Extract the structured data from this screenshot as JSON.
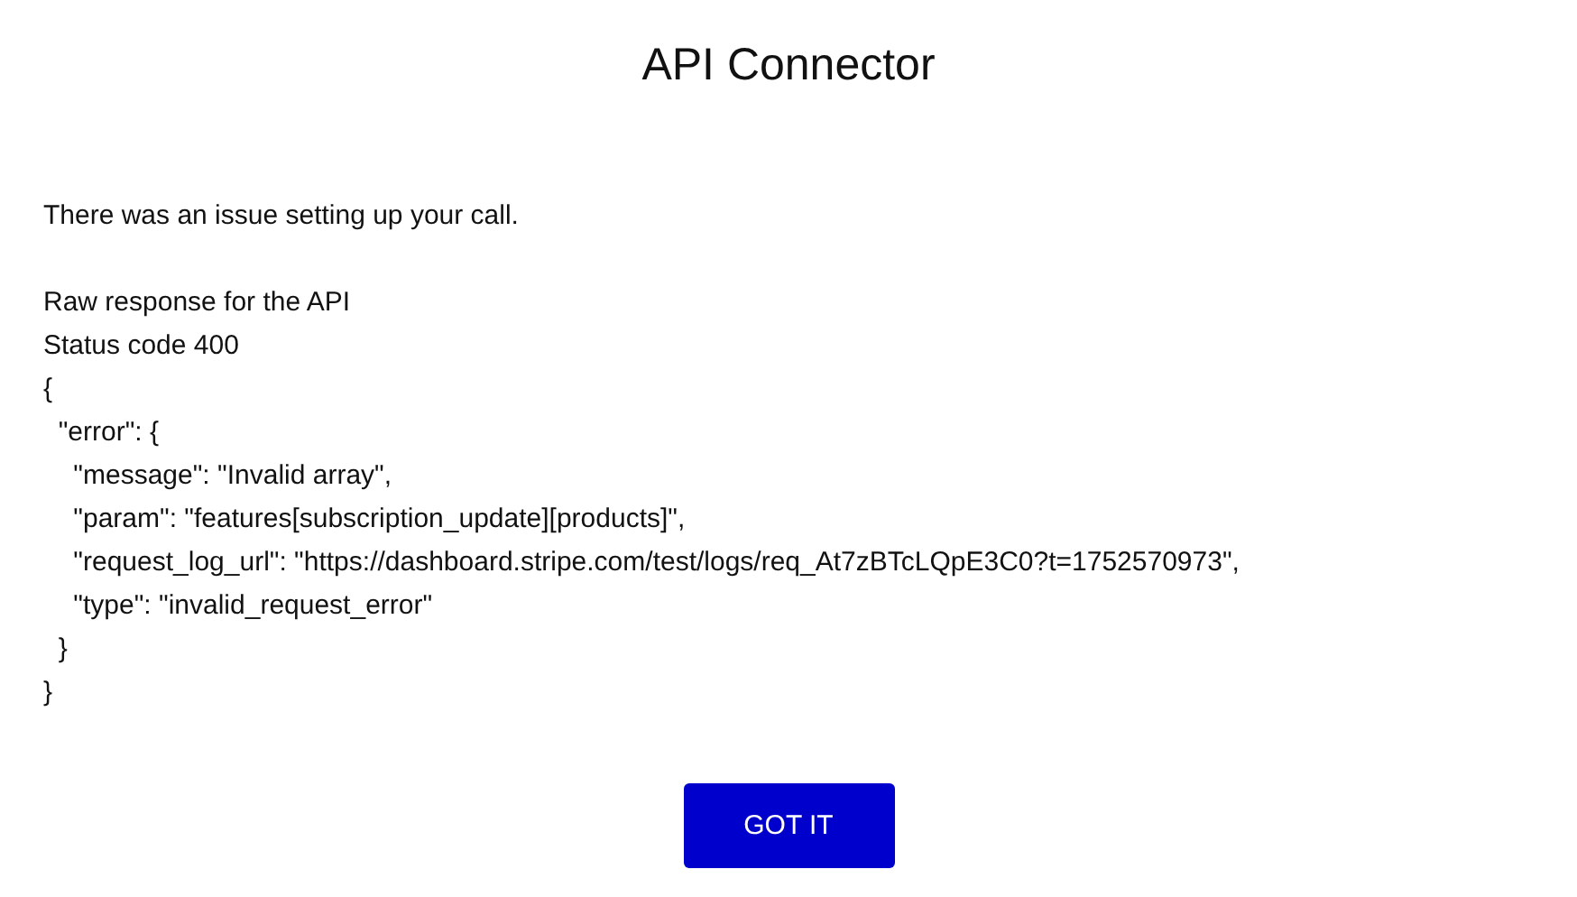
{
  "dialog": {
    "title": "API Connector",
    "message": "There was an issue setting up your call.",
    "response_lines": [
      "Raw response for the API",
      "Status code 400",
      "{",
      "  \"error\": {",
      "    \"message\": \"Invalid array\",",
      "    \"param\": \"features[subscription_update][products]\",",
      "    \"request_log_url\": \"https://dashboard.stripe.com/test/logs/req_At7zBTcLQpE3C0?t=1752570973\",",
      "    \"type\": \"invalid_request_error\"",
      "  }",
      "}"
    ],
    "button": "GOT IT"
  }
}
